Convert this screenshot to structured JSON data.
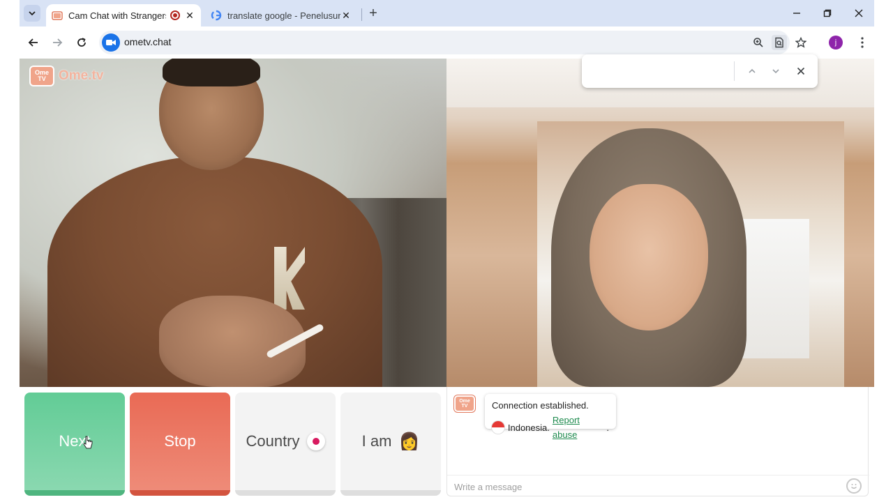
{
  "browser": {
    "tabs": [
      {
        "title": "Cam Chat with Strangers on",
        "active": true
      },
      {
        "title": "translate google - Penelusuran",
        "active": false
      }
    ],
    "url": "ometv.chat",
    "profile_initial": "j",
    "recording_color": "#b3261e"
  },
  "findbar": {
    "query": ""
  },
  "video": {
    "logo_badge_top": "Ome",
    "logo_badge_bottom": "TV",
    "logo_text": "Ome.tv"
  },
  "controls": {
    "next_label": "Next",
    "stop_label": "Stop",
    "country_label": "Country",
    "iam_label": "I am",
    "iam_emoji": "👩",
    "next_color": "#62cc96",
    "stop_color": "#e96a55"
  },
  "chat": {
    "system_line1": "Connection established.",
    "country": "Indonesia.",
    "report_link": "Report abuse",
    "trailing": ".",
    "message_placeholder": "Write a message"
  }
}
